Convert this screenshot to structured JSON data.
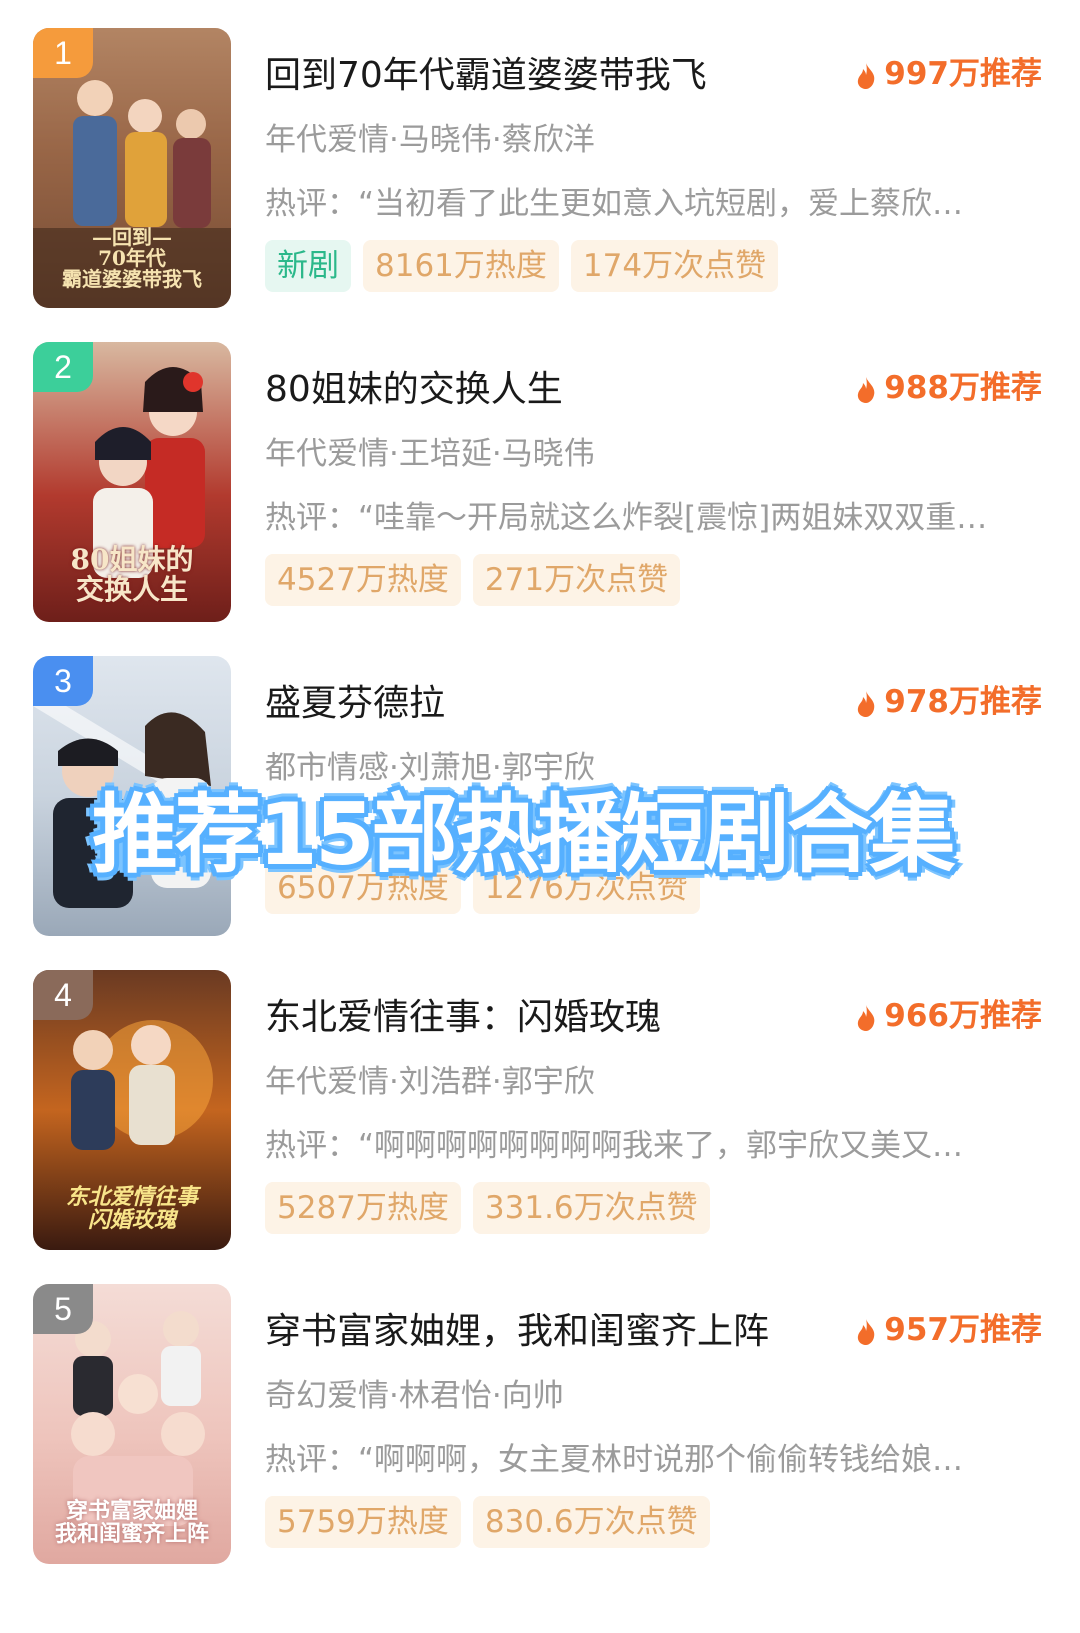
{
  "colors": {
    "accent": "#f36d2a",
    "rank1": "#f59b3c",
    "rank2": "#3ccf9a",
    "rank3": "#4a8ff0",
    "rank_other": "#8a8a8a",
    "new_tag": "#2bb88a",
    "stat_tag": "#e0a769",
    "overlay_stroke": "#56b0ff"
  },
  "items": [
    {
      "rank": "1",
      "title": "回到70年代霸道婆婆带我飞",
      "recommend": "997万推荐",
      "meta": "年代爱情·马晓伟·蔡欣洋",
      "review": "热评：“当初看了此生更如意入坑短剧，爱上蔡欣…",
      "new_tag": "新剧",
      "heat": "8161万热度",
      "likes": "174万次点赞",
      "poster_text": "—回到—\n70年代\n霸道婆婆带我飞"
    },
    {
      "rank": "2",
      "title": "80姐妹的交换人生",
      "recommend": "988万推荐",
      "meta": "年代爱情·王培延·马晓伟",
      "review": "热评：“哇靠～开局就这么炸裂[震惊]两姐妹双双重…",
      "heat": "4527万热度",
      "likes": "271万次点赞",
      "poster_text": "80姐妹的\n交换人生"
    },
    {
      "rank": "3",
      "title": "盛夏芬德拉",
      "recommend": "978万推荐",
      "meta": "都市情感·刘萧旭·郭宇欣",
      "heat": "6507万热度",
      "likes": "1276万次点赞",
      "poster_text": ""
    },
    {
      "rank": "4",
      "title": "东北爱情往事：闪婚玫瑰",
      "recommend": "966万推荐",
      "meta": "年代爱情·刘浩群·郭宇欣",
      "review": "热评：“啊啊啊啊啊啊啊啊我来了，郭宇欣又美又…",
      "heat": "5287万热度",
      "likes": "331.6万次点赞",
      "poster_text": "东北爱情往事\n闪婚玫瑰"
    },
    {
      "rank": "5",
      "title": "穿书富家妯娌，我和闺蜜齐上阵",
      "recommend": "957万推荐",
      "meta": "奇幻爱情·林君怡·向帅",
      "review": "热评：“啊啊啊，女主夏林时说那个偷偷转钱给娘…",
      "heat": "5759万热度",
      "likes": "830.6万次点赞",
      "poster_text": "穿书富家妯娌\n我和闺蜜齐上阵"
    }
  ],
  "overlay_banner": "推荐15部热播短剧合集"
}
